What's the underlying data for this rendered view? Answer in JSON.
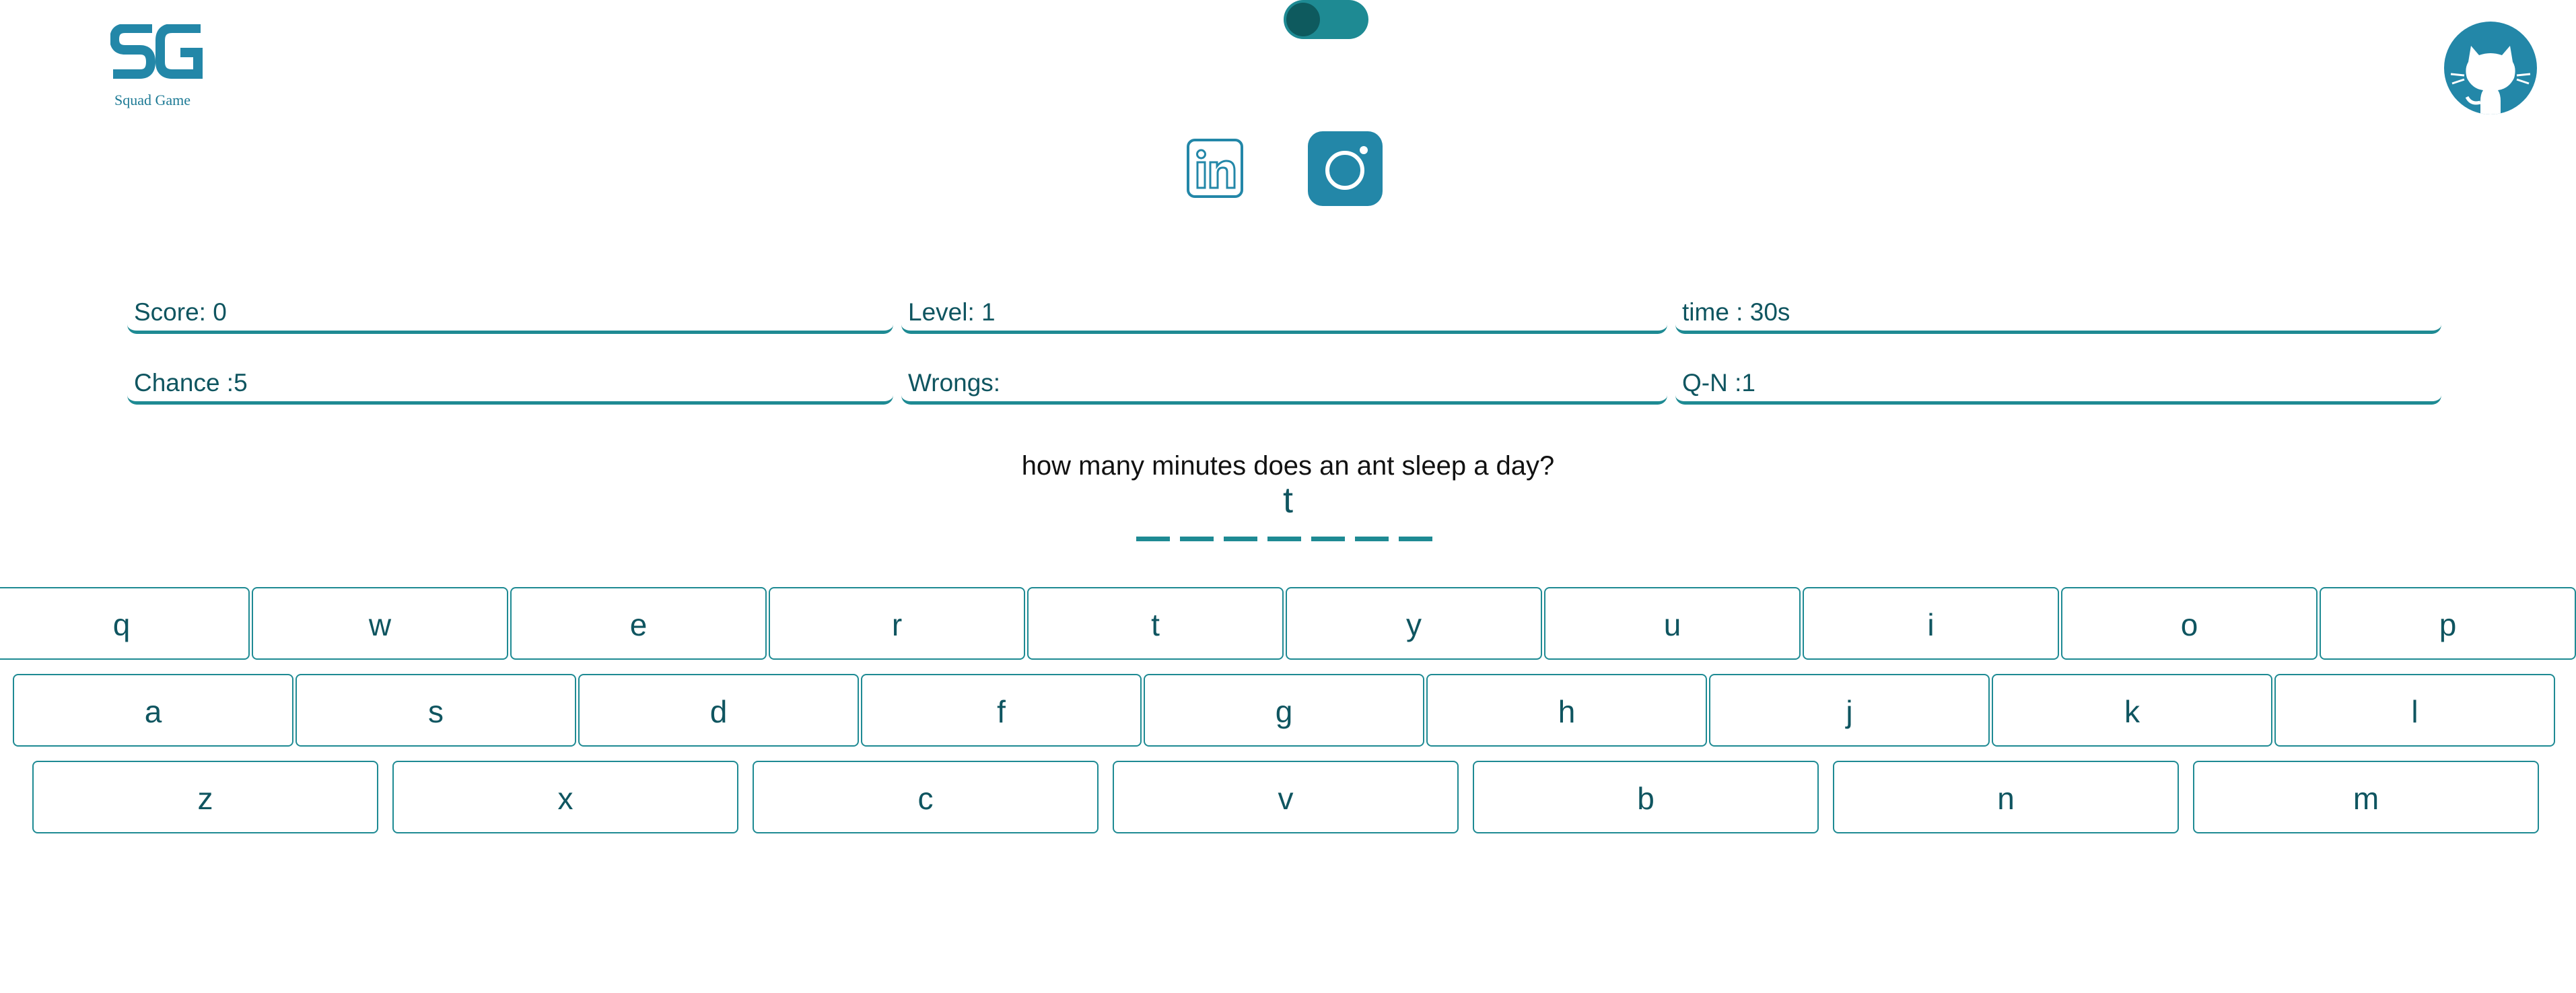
{
  "logo": {
    "monogram": "SG",
    "caption": "Squad Game"
  },
  "theme_toggle": {
    "state": "on"
  },
  "social": {
    "linkedin_icon": "linkedin-icon",
    "instagram_icon": "instagram-icon",
    "github_icon": "github-icon"
  },
  "stats": {
    "score": "Score: 0",
    "level": "Level: 1",
    "time": "time : 30s",
    "chance": "Chance :5",
    "wrongs": "Wrongs:",
    "question_number": "Q-N :1"
  },
  "game": {
    "question": "how many minutes does an ant sleep a day?",
    "revealed": "t",
    "slot_count": 7
  },
  "keyboard": {
    "row1": [
      "q",
      "w",
      "e",
      "r",
      "t",
      "y",
      "u",
      "i",
      "o",
      "p"
    ],
    "row2": [
      "a",
      "s",
      "d",
      "f",
      "g",
      "h",
      "j",
      "k",
      "l"
    ],
    "row3": [
      "z",
      "x",
      "c",
      "v",
      "b",
      "n",
      "m"
    ]
  },
  "colors": {
    "accent": "#1e8a93",
    "icon_blue": "#2387a8",
    "text": "#0f5560"
  }
}
